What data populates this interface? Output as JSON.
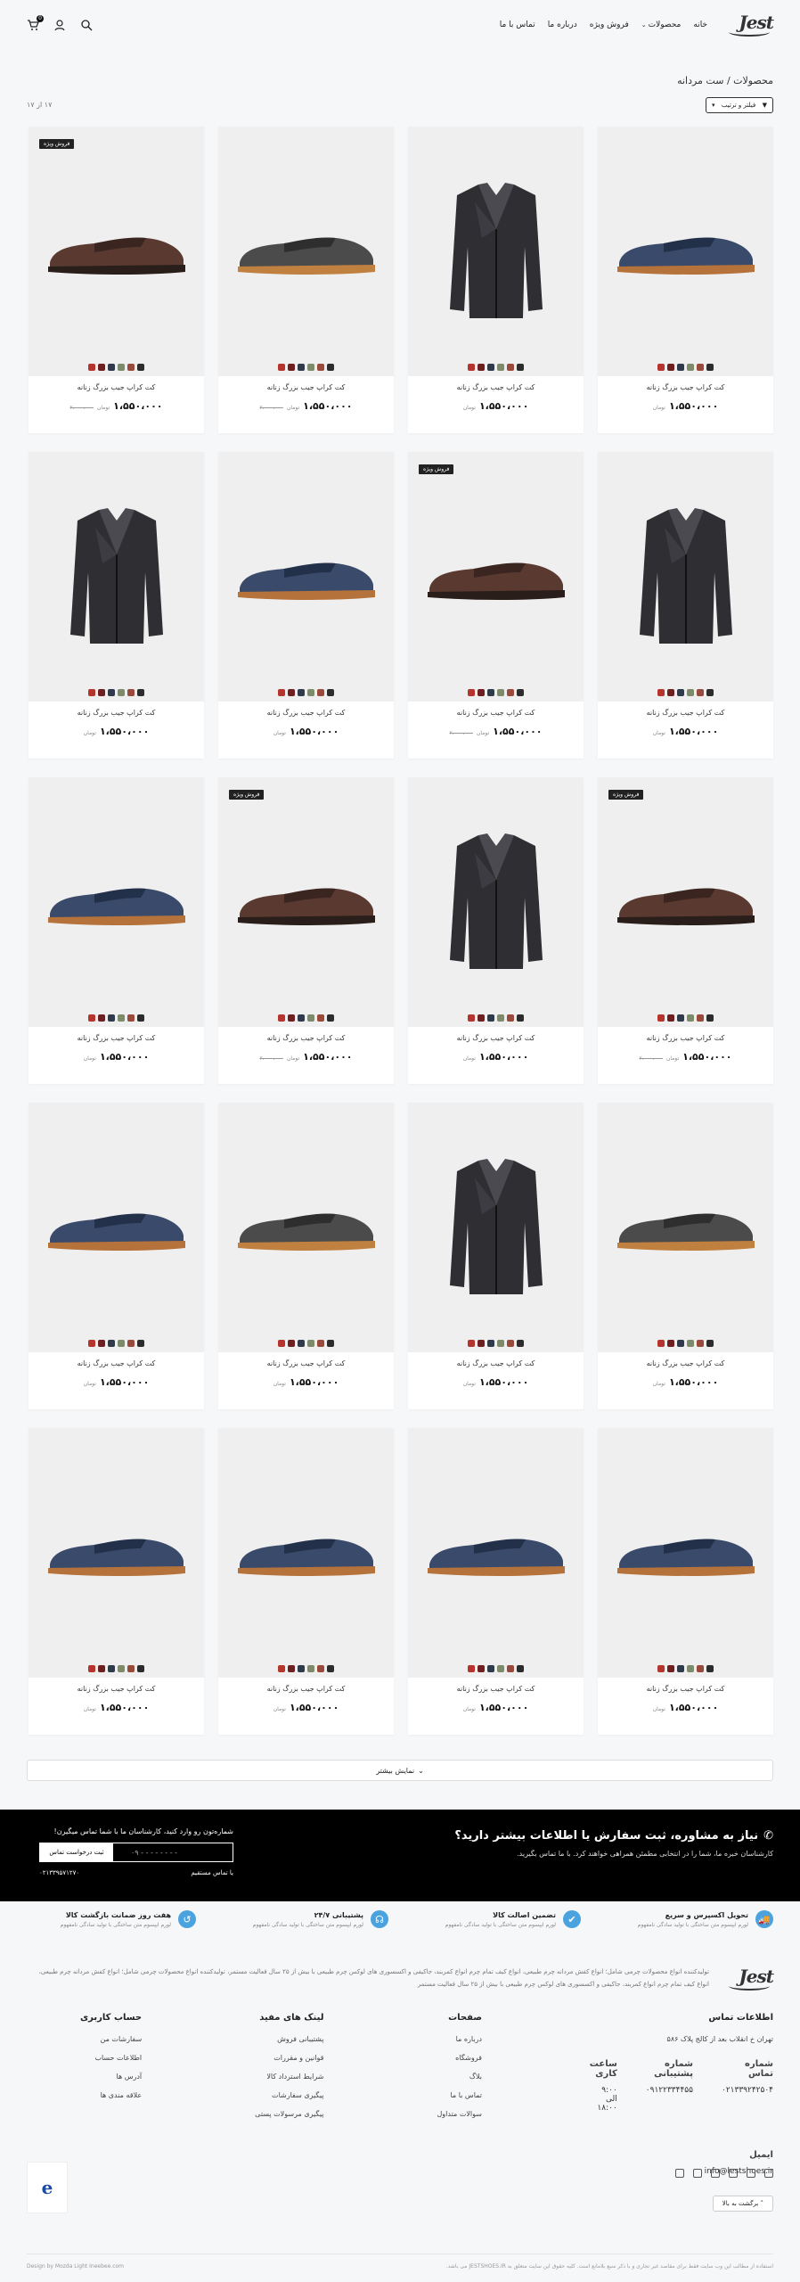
{
  "header": {
    "logo": "Jest",
    "nav": [
      "خانه",
      "محصولات",
      "فروش ویژه",
      "درباره ما",
      "تماس با ما"
    ],
    "cart_count": "0"
  },
  "breadcrumb": "محصولات / ست مردانه",
  "sort_label": "فیلتر و ترتیب",
  "count": "۱۷ از ۱۷",
  "product_title": "کت کراپ جیب بزرگ زنانه",
  "price": "۱،۵۵۰،۰۰۰",
  "old_price": "۲،۰۰۰،۰۰۰",
  "currency": "تومان",
  "badge_label": "فروش ویژه",
  "swatch_colors": [
    "#b5342e",
    "#6e1f1f",
    "#2f3a4a",
    "#7d8b6a",
    "#9a4a3a",
    "#2c2c2c"
  ],
  "products": [
    {
      "type": "shoe-blue",
      "badge": false,
      "old": false
    },
    {
      "type": "jacket",
      "badge": false,
      "old": false
    },
    {
      "type": "loafer",
      "badge": false,
      "old": true
    },
    {
      "type": "shoe-brown",
      "badge": true,
      "old": true
    },
    {
      "type": "jacket",
      "badge": false,
      "old": false
    },
    {
      "type": "shoe-brown",
      "badge": true,
      "old": true
    },
    {
      "type": "shoe-blue",
      "badge": false,
      "old": false
    },
    {
      "type": "jacket",
      "badge": false,
      "old": false
    },
    {
      "type": "shoe-brown",
      "badge": true,
      "old": true
    },
    {
      "type": "jacket",
      "badge": false,
      "old": false
    },
    {
      "type": "shoe-brown",
      "badge": true,
      "old": true
    },
    {
      "type": "shoe-blue",
      "badge": false,
      "old": false
    },
    {
      "type": "loafer",
      "badge": false,
      "old": false
    },
    {
      "type": "jacket",
      "badge": false,
      "old": false
    },
    {
      "type": "loafer",
      "badge": false,
      "old": false
    },
    {
      "type": "shoe-blue",
      "badge": false,
      "old": false
    },
    {
      "type": "shoe-blue",
      "badge": false,
      "old": false
    },
    {
      "type": "shoe-blue",
      "badge": false,
      "old": false
    },
    {
      "type": "shoe-blue",
      "badge": false,
      "old": false
    },
    {
      "type": "shoe-blue",
      "badge": false,
      "old": false
    }
  ],
  "load_more": "نمایش بیشتر",
  "consult": {
    "heading": "نیاز به مشاوره، ثبت سفارش یا اطلاعات بیشتر دارید؟",
    "sub": "کارشناسان خبره ما، شما را در انتخابی مطمئن همراهی خواهند کرد. با ما تماس بگیرید.",
    "form_title": "شماره‌تون رو وارد کنید، کارشناسان ما با شما تماس میگیرن!",
    "phone_placeholder": "۰۹ - - - - - - - -",
    "submit": "ثبت درخواست تماس",
    "direct": "یا تماس مستقیم",
    "phone": "۰۲۱۳۳۹۵۷۱۲۷۰"
  },
  "features": [
    {
      "title": "تحویل اکسپرس و سریع",
      "desc": "لورم ایپسوم متن ساختگی با تولید سادگی نامفهوم",
      "icon": "truck-icon",
      "symbol": "🚚"
    },
    {
      "title": "تضمین اصالت کالا",
      "desc": "لورم ایپسوم متن ساختگی با تولید سادگی نامفهوم",
      "icon": "check-badge-icon",
      "symbol": "✔"
    },
    {
      "title": "پشتیبانی ۲۴/۷",
      "desc": "لورم ایپسوم متن ساختگی با تولید سادگی نامفهوم",
      "icon": "headset-icon",
      "symbol": "☊"
    },
    {
      "title": "هفت روز ضمانت بازگشت کالا",
      "desc": "لورم ایپسوم متن ساختگی با تولید سادگی نامفهوم",
      "icon": "return-icon",
      "symbol": "↺"
    }
  ],
  "about": "تولیدکننده انواع محصولات چرمی شامل؛ انواع کفش مردانه چرم طبیعی، انواع کیف تمام چرم انواع کمربند، جاکیفی و اکسسوری های لوکس چرم طبیعی با بیش از ۲۵ سال فعالیت مستمر، تولیدکننده انواع محصولات چرمی شامل؛ انواع کفش مردانه چرم طبیعی، انواع کیف تمام چرم انواع کمربند، جاکیفی و اکسسوری های لوکس چرم طبیعی با بیش از ۲۵ سال فعالیت مستمر",
  "footer": {
    "contact_title": "اطلاعات تماس",
    "address": "تهران خ انقلاب بعد از کالج پلاک ۵۸۶",
    "phone_label": "شماره تماس",
    "phone": "۰۲۱۳۳۹۲۴۲۵۰۴",
    "support_label": "شماره پشتیبانی",
    "support": "۰۹۱۲۲۳۳۴۴۵۵",
    "hours_label": "ساعت کاری",
    "hours": "۹:۰۰ الی ۱۸:۰۰",
    "email_label": "ایمیل",
    "email": "info@lestshoes.ir",
    "pages_title": "صفحات",
    "pages": [
      "درباره ما",
      "فروشگاه",
      "بلاگ",
      "تماس با ما",
      "سوالات متداول"
    ],
    "links_title": "لینک های مفید",
    "links": [
      "پشتیبانی فروش",
      "قوانین و مقررات",
      "شرایط استرداد کالا",
      "پیگیری سفارشات",
      "پیگیری مرسولات پستی"
    ],
    "account_title": "حساب کاربری",
    "account": [
      "سفارشات من",
      "اطلاعات حساب",
      "آدرس ها",
      "علاقه مندی ها"
    ],
    "back_top": "برگشت به بالا",
    "copyright": "استفاده از مطالب این وب سایت فقط برای مقاصد غیر تجاری و با ذکر منبع بلامانع است. کلیه حقوق این سایت متعلق به JESTSHOES.IR می باشد.",
    "credit": "Design by Mozda Light Ineebee.com"
  }
}
